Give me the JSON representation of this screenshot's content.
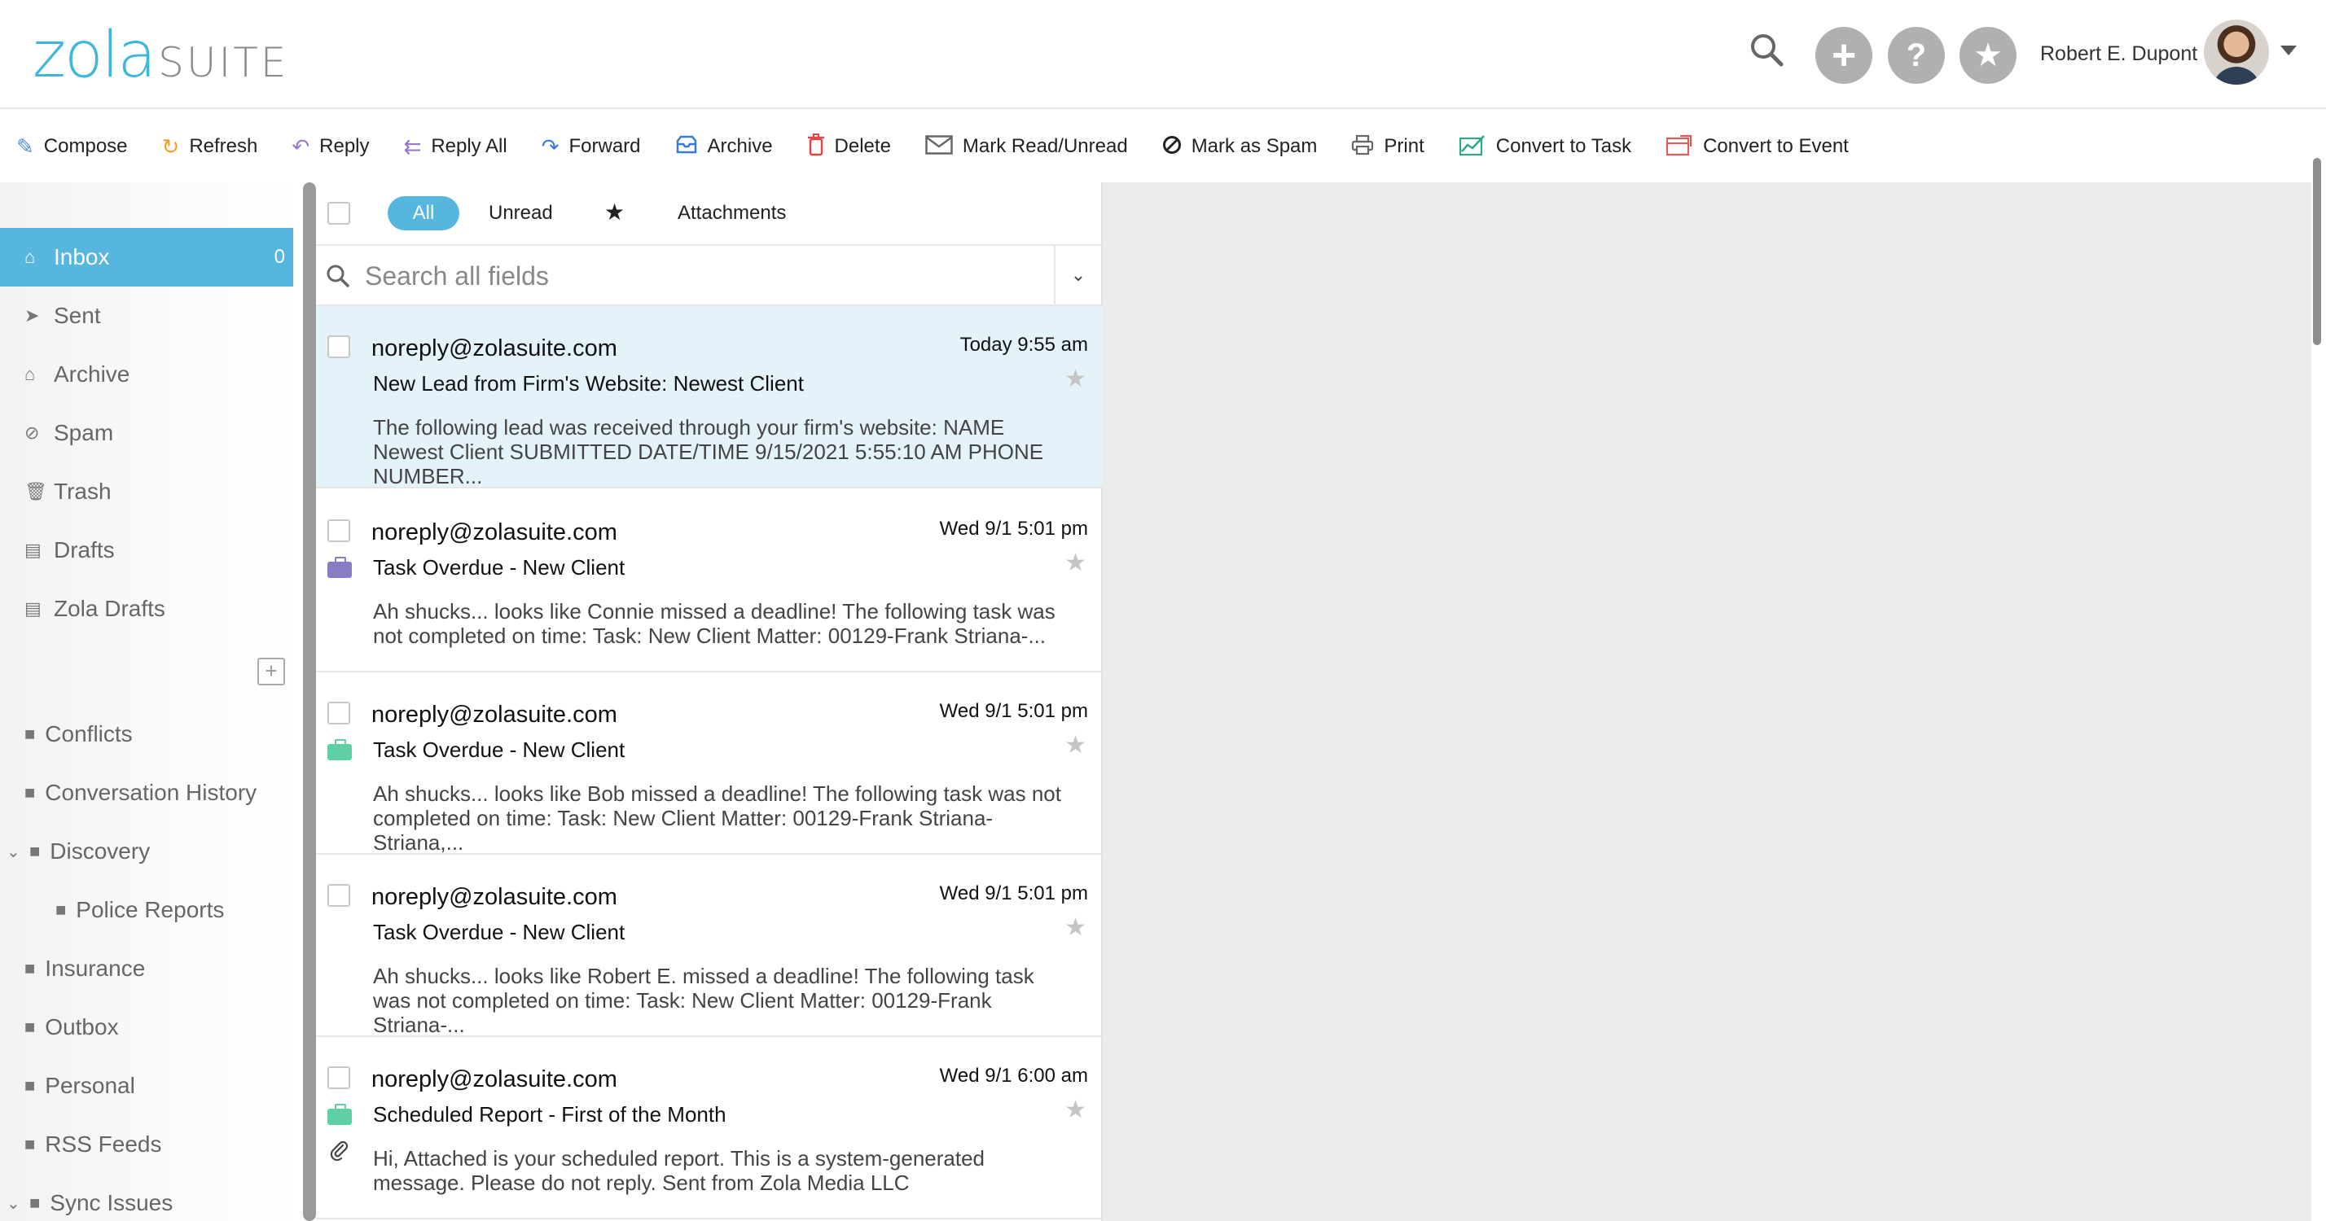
{
  "header": {
    "logo_zola": "zola",
    "logo_suite": "SUITE",
    "user_name": "Robert E. Dupont",
    "icons": [
      "search-icon",
      "plus-icon",
      "help-icon",
      "star-icon"
    ]
  },
  "toolbar": {
    "compose": "Compose",
    "refresh": "Refresh",
    "reply": "Reply",
    "reply_all": "Reply All",
    "forward": "Forward",
    "archive": "Archive",
    "delete": "Delete",
    "mark_read": "Mark Read/Unread",
    "mark_spam": "Mark as Spam",
    "print": "Print",
    "convert_task": "Convert to Task",
    "convert_event": "Convert to Event"
  },
  "sidebar": {
    "items": [
      {
        "label": "Inbox",
        "count": "0"
      },
      {
        "label": "Sent"
      },
      {
        "label": "Archive"
      },
      {
        "label": "Spam"
      },
      {
        "label": "Trash"
      },
      {
        "label": "Drafts"
      },
      {
        "label": "Zola Drafts"
      }
    ],
    "folders": [
      {
        "label": "Conflicts"
      },
      {
        "label": "Conversation History"
      },
      {
        "label": "Discovery"
      },
      {
        "label": "Police Reports"
      },
      {
        "label": "Insurance"
      },
      {
        "label": "Outbox"
      },
      {
        "label": "Personal"
      },
      {
        "label": "RSS Feeds"
      },
      {
        "label": "Sync Issues"
      }
    ]
  },
  "filters": {
    "all": "All",
    "unread": "Unread",
    "attachments": "Attachments"
  },
  "search": {
    "placeholder": "Search all fields"
  },
  "messages": [
    {
      "from": "noreply@zolasuite.com",
      "date": "Today 9:55 am",
      "subject": "New Lead from Firm's Website: Newest Client",
      "preview": "The following lead was received through your firm's website: NAME Newest Client SUBMITTED DATE/TIME 9/15/2021 5:55:10 AM PHONE NUMBER..."
    },
    {
      "from": "noreply@zolasuite.com",
      "date": "Wed 9/1 5:01 pm",
      "subject": "Task Overdue - New Client",
      "preview": "Ah shucks... looks like Connie missed a deadline! The following task was not completed on time: Task: New Client Matter: 00129-Frank Striana-...",
      "tag_color": "#8a7cc4"
    },
    {
      "from": "noreply@zolasuite.com",
      "date": "Wed 9/1 5:01 pm",
      "subject": "Task Overdue - New Client",
      "preview": "Ah shucks... looks like Bob missed a deadline! The following task was not completed on time: Task: New Client Matter: 00129-Frank Striana-Striana,...",
      "tag_color": "#5fd0a6"
    },
    {
      "from": "noreply@zolasuite.com",
      "date": "Wed 9/1 5:01 pm",
      "subject": "Task Overdue - New Client",
      "preview": "Ah shucks... looks like Robert E. missed a deadline! The following task was not completed on time: Task: New Client Matter: 00129-Frank Striana-..."
    },
    {
      "from": "noreply@zolasuite.com",
      "date": "Wed 9/1 6:00 am",
      "subject": "Scheduled Report - First of the Month",
      "preview": "Hi, Attached is your scheduled report. This is a system-generated message. Please do not reply. Sent from Zola Media LLC",
      "tag_color": "#5fd0a6"
    }
  ]
}
